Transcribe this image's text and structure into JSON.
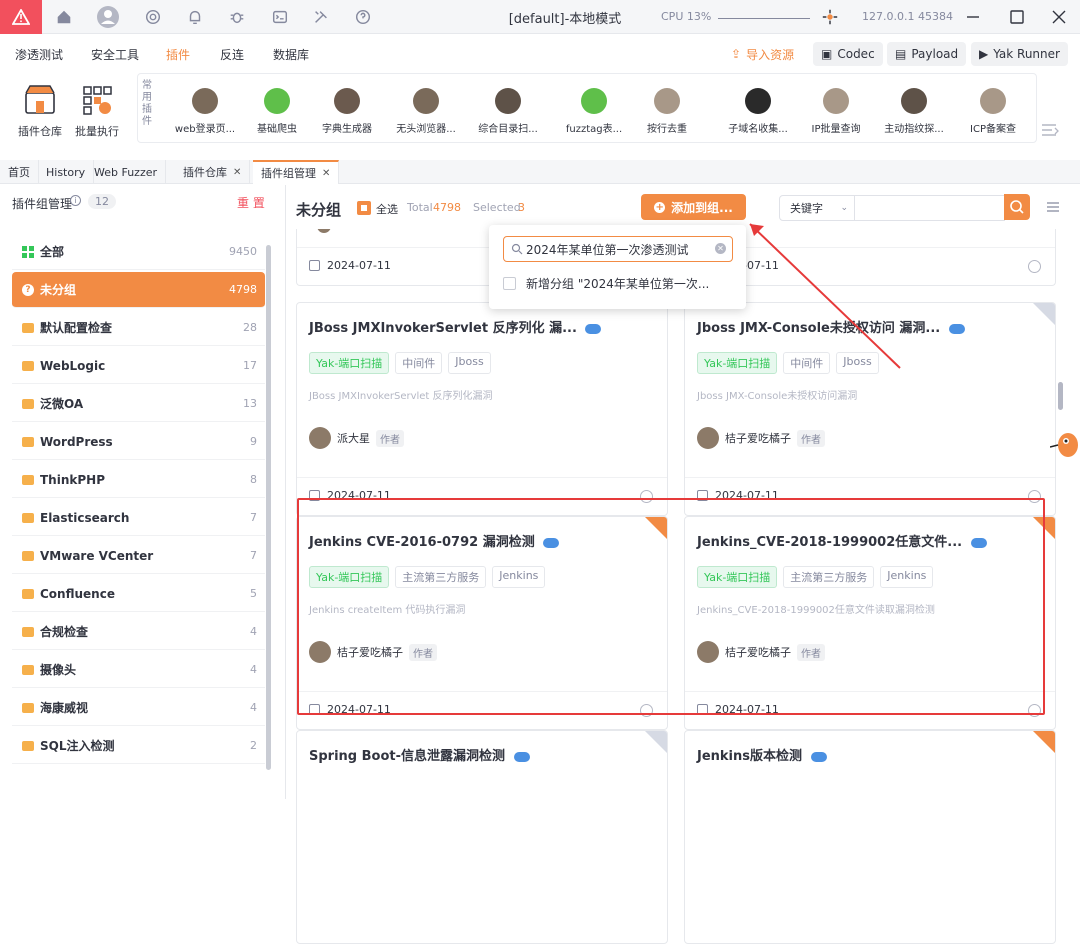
{
  "titlebar": {
    "title": "[default]-本地模式",
    "cpu": "CPU 13%",
    "ip": "127.0.0.1 45384"
  },
  "menu": {
    "items": [
      "渗透测试",
      "安全工具",
      "插件",
      "反连",
      "数据库"
    ],
    "active": "插件",
    "import": "导入资源",
    "codec": "Codec",
    "payload": "Payload",
    "runner": "Yak Runner"
  },
  "toolbar": {
    "repo": "插件仓库",
    "batch": "批量执行",
    "vertical": "常用插件",
    "plugins": [
      "web登录页...",
      "基础爬虫",
      "字典生成器",
      "无头浏览器...",
      "综合目录扫...",
      "fuzztag表...",
      "按行去重",
      "子域名收集...",
      "IP批量查询",
      "主动指纹探...",
      "ICP备案查"
    ]
  },
  "tabs": [
    "首页",
    "History",
    "Web Fuzzer",
    "插件仓库",
    "插件组管理"
  ],
  "sidebar": {
    "header": "插件组管理",
    "count": "12",
    "reset": "重 置",
    "items": [
      {
        "name": "全部",
        "count": "9450"
      },
      {
        "name": "未分组",
        "count": "4798"
      },
      {
        "name": "默认配置检查",
        "count": "28"
      },
      {
        "name": "WebLogic",
        "count": "17"
      },
      {
        "name": "泛微OA",
        "count": "13"
      },
      {
        "name": "WordPress",
        "count": "9"
      },
      {
        "name": "ThinkPHP",
        "count": "8"
      },
      {
        "name": "Elasticsearch",
        "count": "7"
      },
      {
        "name": "VMware VCenter",
        "count": "7"
      },
      {
        "name": "Confluence",
        "count": "5"
      },
      {
        "name": "合规检查",
        "count": "4"
      },
      {
        "name": "摄像头",
        "count": "4"
      },
      {
        "name": "海康威视",
        "count": "4"
      },
      {
        "name": "SQL注入检测",
        "count": "2"
      }
    ]
  },
  "main": {
    "title": "未分组",
    "select_all": "全选",
    "total_label": "Total",
    "total": "4798",
    "selected_label": "Selected",
    "selected": "3",
    "add_btn": "添加到组...",
    "keyword": "关键字"
  },
  "popup": {
    "input": "2024年某单位第一次渗透测试",
    "option": "新增分组 \"2024年某单位第一次..."
  },
  "cards": [
    {
      "title": "",
      "tags": [],
      "desc": "",
      "author": "",
      "date": "2024-07-11"
    },
    {
      "title": "",
      "tags": [],
      "desc": "",
      "author": "",
      "date": "2024-07-11"
    },
    {
      "title": "JBoss JMXInvokerServlet 反序列化 漏...",
      "tags": [
        "Yak-端口扫描",
        "中间件",
        "Jboss"
      ],
      "desc": "JBoss JMXInvokerServlet 反序列化漏洞",
      "author": "派大星",
      "badge": "作者",
      "date": "2024-07-11"
    },
    {
      "title": "Jboss JMX-Console未授权访问 漏洞...",
      "tags": [
        "Yak-端口扫描",
        "中间件",
        "Jboss"
      ],
      "desc": "Jboss JMX-Console未授权访问漏洞",
      "author": "桔子爱吃橘子",
      "badge": "作者",
      "date": "2024-07-11"
    },
    {
      "title": "Jenkins CVE-2016-0792 漏洞检测",
      "tags": [
        "Yak-端口扫描",
        "主流第三方服务",
        "Jenkins"
      ],
      "desc": "Jenkins createItem 代码执行漏洞",
      "author": "桔子爱吃橘子",
      "badge": "作者",
      "date": "2024-07-11"
    },
    {
      "title": "Jenkins_CVE-2018-1999002任意文件...",
      "tags": [
        "Yak-端口扫描",
        "主流第三方服务",
        "Jenkins"
      ],
      "desc": "Jenkins_CVE-2018-1999002任意文件读取漏洞检测",
      "author": "桔子爱吃橘子",
      "badge": "作者",
      "date": "2024-07-11"
    },
    {
      "title": "Spring Boot-信息泄露漏洞检测",
      "tags": [],
      "desc": "",
      "author": "",
      "date": ""
    },
    {
      "title": "Jenkins版本检测",
      "tags": [],
      "desc": "",
      "author": "",
      "date": ""
    }
  ]
}
